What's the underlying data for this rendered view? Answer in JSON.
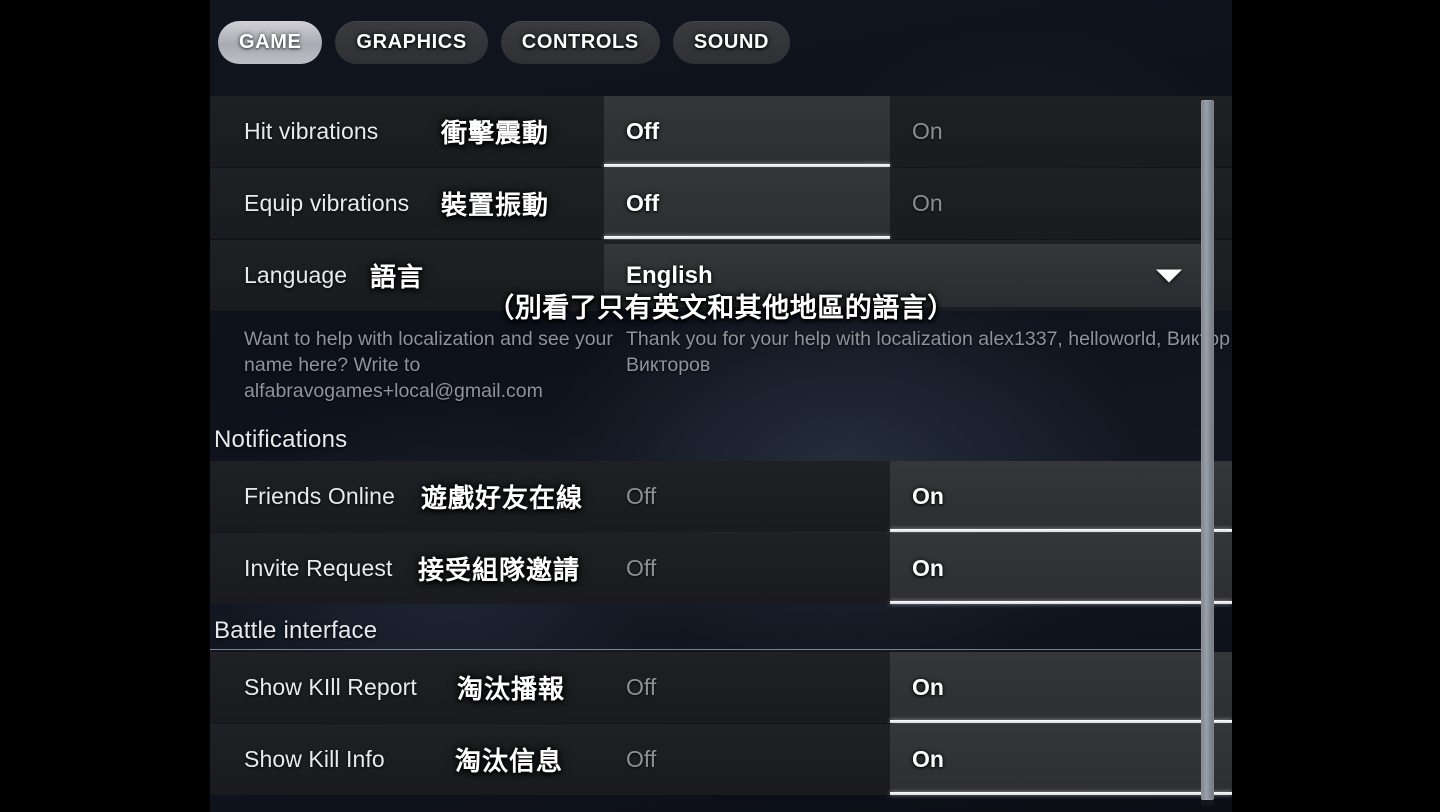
{
  "tabs": [
    {
      "label": "GAME",
      "active": true
    },
    {
      "label": "GRAPHICS",
      "active": false
    },
    {
      "label": "CONTROLS",
      "active": false
    },
    {
      "label": "SOUND",
      "active": false
    }
  ],
  "caption": "（別看了只有英文和其他地區的語言）",
  "settings": {
    "hit_vibrations": {
      "en": "Hit vibrations",
      "cn": "衝擊震動",
      "off": "Off",
      "on": "On",
      "selected": "Off"
    },
    "equip_vibrations": {
      "en": "Equip vibrations",
      "cn": "裝置振動",
      "off": "Off",
      "on": "On",
      "selected": "Off"
    },
    "language": {
      "en": "Language",
      "cn": "語言",
      "value": "English",
      "caret": "chevron-down-icon"
    }
  },
  "localization_note": {
    "left": "Want to help with localization and see your name here? Write to alfabravogames+local@gmail.com",
    "right": "Thank you for your help with localization alex1337, helloworld, Виктор Викторов"
  },
  "sections": {
    "notifications": {
      "heading": "Notifications",
      "rows": {
        "friends_online": {
          "en": "Friends Online",
          "cn": "遊戲好友在線",
          "off": "Off",
          "on": "On",
          "selected": "On"
        },
        "invite_request": {
          "en": "Invite Request",
          "cn": "接受組隊邀請",
          "off": "Off",
          "on": "On",
          "selected": "On"
        }
      }
    },
    "battle_interface": {
      "heading": "Battle interface",
      "rows": {
        "show_kill_report": {
          "en": "Show KIll Report",
          "cn": "淘汰播報",
          "off": "Off",
          "on": "On",
          "selected": "On"
        },
        "show_kill_info": {
          "en": "Show Kill Info",
          "cn": "淘汰信息",
          "off": "Off",
          "on": "On",
          "selected": "On"
        }
      }
    }
  },
  "colors": {
    "accent_selected": "#ffffff",
    "row_background": "#1e2024",
    "selected_option_background": "#34363a",
    "muted_text": "#8c8f94",
    "letterbox": "#000000"
  }
}
